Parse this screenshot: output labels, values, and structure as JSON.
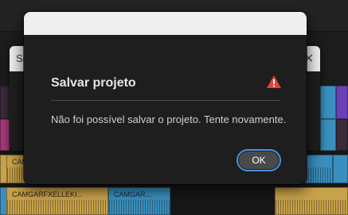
{
  "alert_dialog": {
    "title": "Salvar projeto",
    "message": "Não foi possível salvar o projeto. Tente novamente.",
    "ok_label": "OK",
    "warning_icon": "warning-triangle-icon",
    "warning_color": "#e0443a",
    "focus_ring_color": "#4a8fe3"
  },
  "background_dialog": {
    "title_fragment": "Sa",
    "close_glyph": "✕"
  },
  "timeline": {
    "clip_labels": {
      "left_a": "CAMGAR",
      "left_b": "CAMGAR",
      "long_a": "CAMGARFXELLEKI...",
      "long_b": "CAMGAR..."
    },
    "colors": {
      "audio_gold": "#c8a24a",
      "audio_blue": "#3a8fbe",
      "label_magenta": "#a43a78",
      "label_purple": "#6b3fb5"
    }
  }
}
